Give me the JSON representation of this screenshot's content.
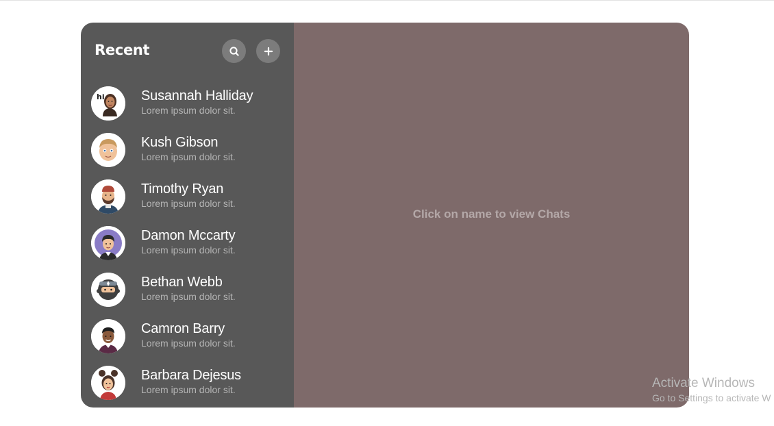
{
  "sidebar": {
    "title": "Recent",
    "search_icon": "search-icon",
    "add_icon": "plus-icon",
    "contacts": [
      {
        "name": "Susannah Halliday",
        "preview": "Lorem ipsum dolor sit.",
        "avatar": "avatar-hi-woman"
      },
      {
        "name": "Kush Gibson",
        "preview": "Lorem ipsum dolor sit.",
        "avatar": "avatar-blond-man"
      },
      {
        "name": "Timothy Ryan",
        "preview": "Lorem ipsum dolor sit.",
        "avatar": "avatar-bearded-man"
      },
      {
        "name": "Damon Mccarty",
        "preview": "Lorem ipsum dolor sit.",
        "avatar": "avatar-purple-man"
      },
      {
        "name": "Bethan Webb",
        "preview": "Lorem ipsum dolor sit.",
        "avatar": "avatar-ninja"
      },
      {
        "name": "Camron Barry",
        "preview": "Lorem ipsum dolor sit.",
        "avatar": "avatar-dark-man"
      },
      {
        "name": "Barbara Dejesus",
        "preview": "Lorem ipsum dolor sit.",
        "avatar": "avatar-bun-woman"
      }
    ]
  },
  "chat": {
    "placeholder": "Click on name to view Chats"
  },
  "watermark": {
    "title": "Activate Windows",
    "subtitle": "Go to Settings to activate W"
  },
  "colors": {
    "sidebar_bg": "#585858",
    "chat_bg": "#7e6a6a",
    "icon_button_bg": "#7c7c7c"
  }
}
